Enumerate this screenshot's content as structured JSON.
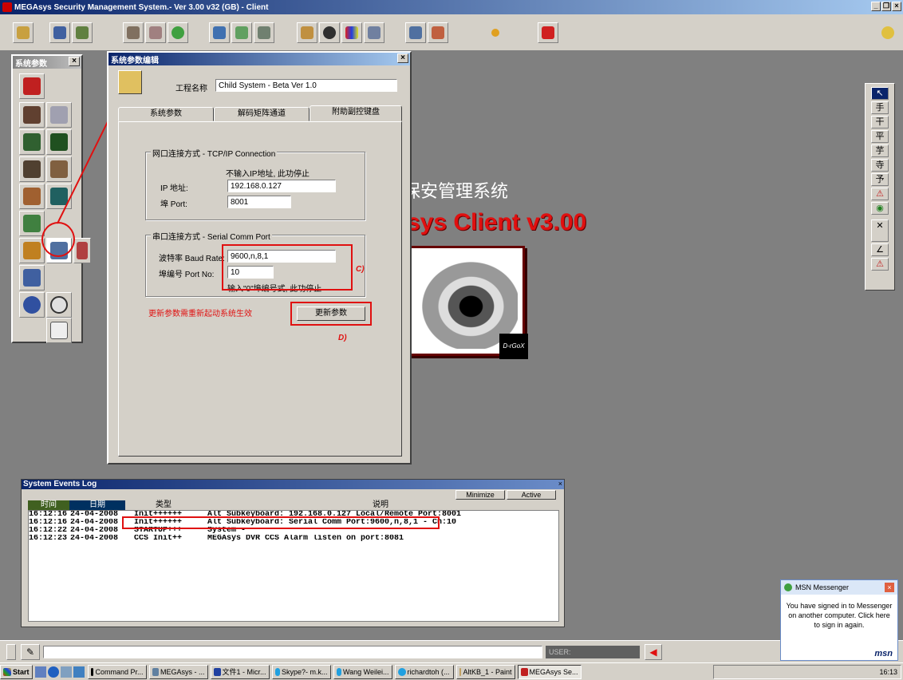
{
  "app": {
    "title": "MEGAsys Security Management System.- Ver 3.00 v32 (GB) - Client"
  },
  "colors": {
    "title_blue": "#0a246a",
    "annotation_red": "#e01010",
    "desktop": "#808080"
  },
  "toolbar": {
    "icons": [
      "lock-icon",
      "network-icon",
      "tree-icon",
      "printer-icon",
      "map-icon",
      "clock-icon",
      "camera-icon",
      "image-icon",
      "film-icon",
      "figure-icon",
      "disc-icon",
      "color-icon",
      "grid-icon",
      "settings-icon",
      "tools-icon",
      "status-icon",
      "alarm-icon",
      "help-icon"
    ]
  },
  "param_palette": {
    "title": "系统参数"
  },
  "param_editor": {
    "title": "系统参数编辑",
    "project_name_label": "工程名称",
    "project_name_value": "Child System - Beta Ver 1.0",
    "tabs": [
      "系统参数",
      "解码矩阵通道",
      "附助副控键盘"
    ],
    "tcp_group": {
      "title": "网口连接方式 - TCP/IP Connection",
      "hint": "不输入IP地址, 此功停止",
      "ip_label": "IP 地址:",
      "ip_value": "192.168.0.127",
      "port_label": "埠 Port:",
      "port_value": "8001"
    },
    "serial_group": {
      "title": "串口连接方式 - Serial Comm Port",
      "baud_label": "波特率 Baud Rate:",
      "baud_value": "9600,n,8,1",
      "portno_label": "埠编号  Port No:",
      "portno_value": "10",
      "hint": "输入\"0\"埠编号式, 此功停止"
    },
    "note": "更新参数需重新起动系统生效",
    "update_button": "更新参数",
    "annotation_c": "C)",
    "annotation_d": "D)"
  },
  "background": {
    "title_cn": "保安管理系统",
    "title_en": "sys Client v3.00",
    "logo_text": "D-rGoX"
  },
  "events_log": {
    "title": "System Events Log",
    "minimize_label": "Minimize",
    "active_label": "Active",
    "columns": [
      "时间",
      "日期",
      "类型",
      "说明"
    ],
    "rows": [
      {
        "time": "16:12:16",
        "date": "24-04-2008",
        "type": "Init++++++",
        "desc": "Alt Subkeyboard: 192.168.0.127 Local/Remote Port:8001"
      },
      {
        "time": "16:12:16",
        "date": "24-04-2008",
        "type": "Init++++++",
        "desc": "Alt Subkeyboard: Serial Comm Port:9600,n,8,1 - Ch:10"
      },
      {
        "time": "16:12:22",
        "date": "24-04-2008",
        "type": "STARTUP+++",
        "desc": "System -"
      },
      {
        "time": "16:12:23",
        "date": "24-04-2008",
        "type": "CCS Init++",
        "desc": "MEGAsys DVR CCS Alarm listen on port:8081"
      }
    ]
  },
  "status_bar": {
    "user_label": "USER:"
  },
  "right_panel": {
    "buttons": [
      "手",
      "干",
      "平",
      "芋",
      "寺",
      "予",
      "⚠",
      "◉",
      "✕",
      "∠",
      "⚠"
    ]
  },
  "msn": {
    "title": "MSN Messenger",
    "message": "You have signed in to Messenger on another computer. Click here to sign in again.",
    "brand": "msn"
  },
  "taskbar": {
    "start_label": "Start",
    "items": [
      "Command Pr...",
      "MEGAsys - ...",
      "文件1 - Micr...",
      "Skype?- m.k...",
      "Wang Weilei...",
      "richardtoh (...",
      "AltKB_1 - Paint",
      "MEGAsys Se..."
    ],
    "clock": "16:13"
  }
}
